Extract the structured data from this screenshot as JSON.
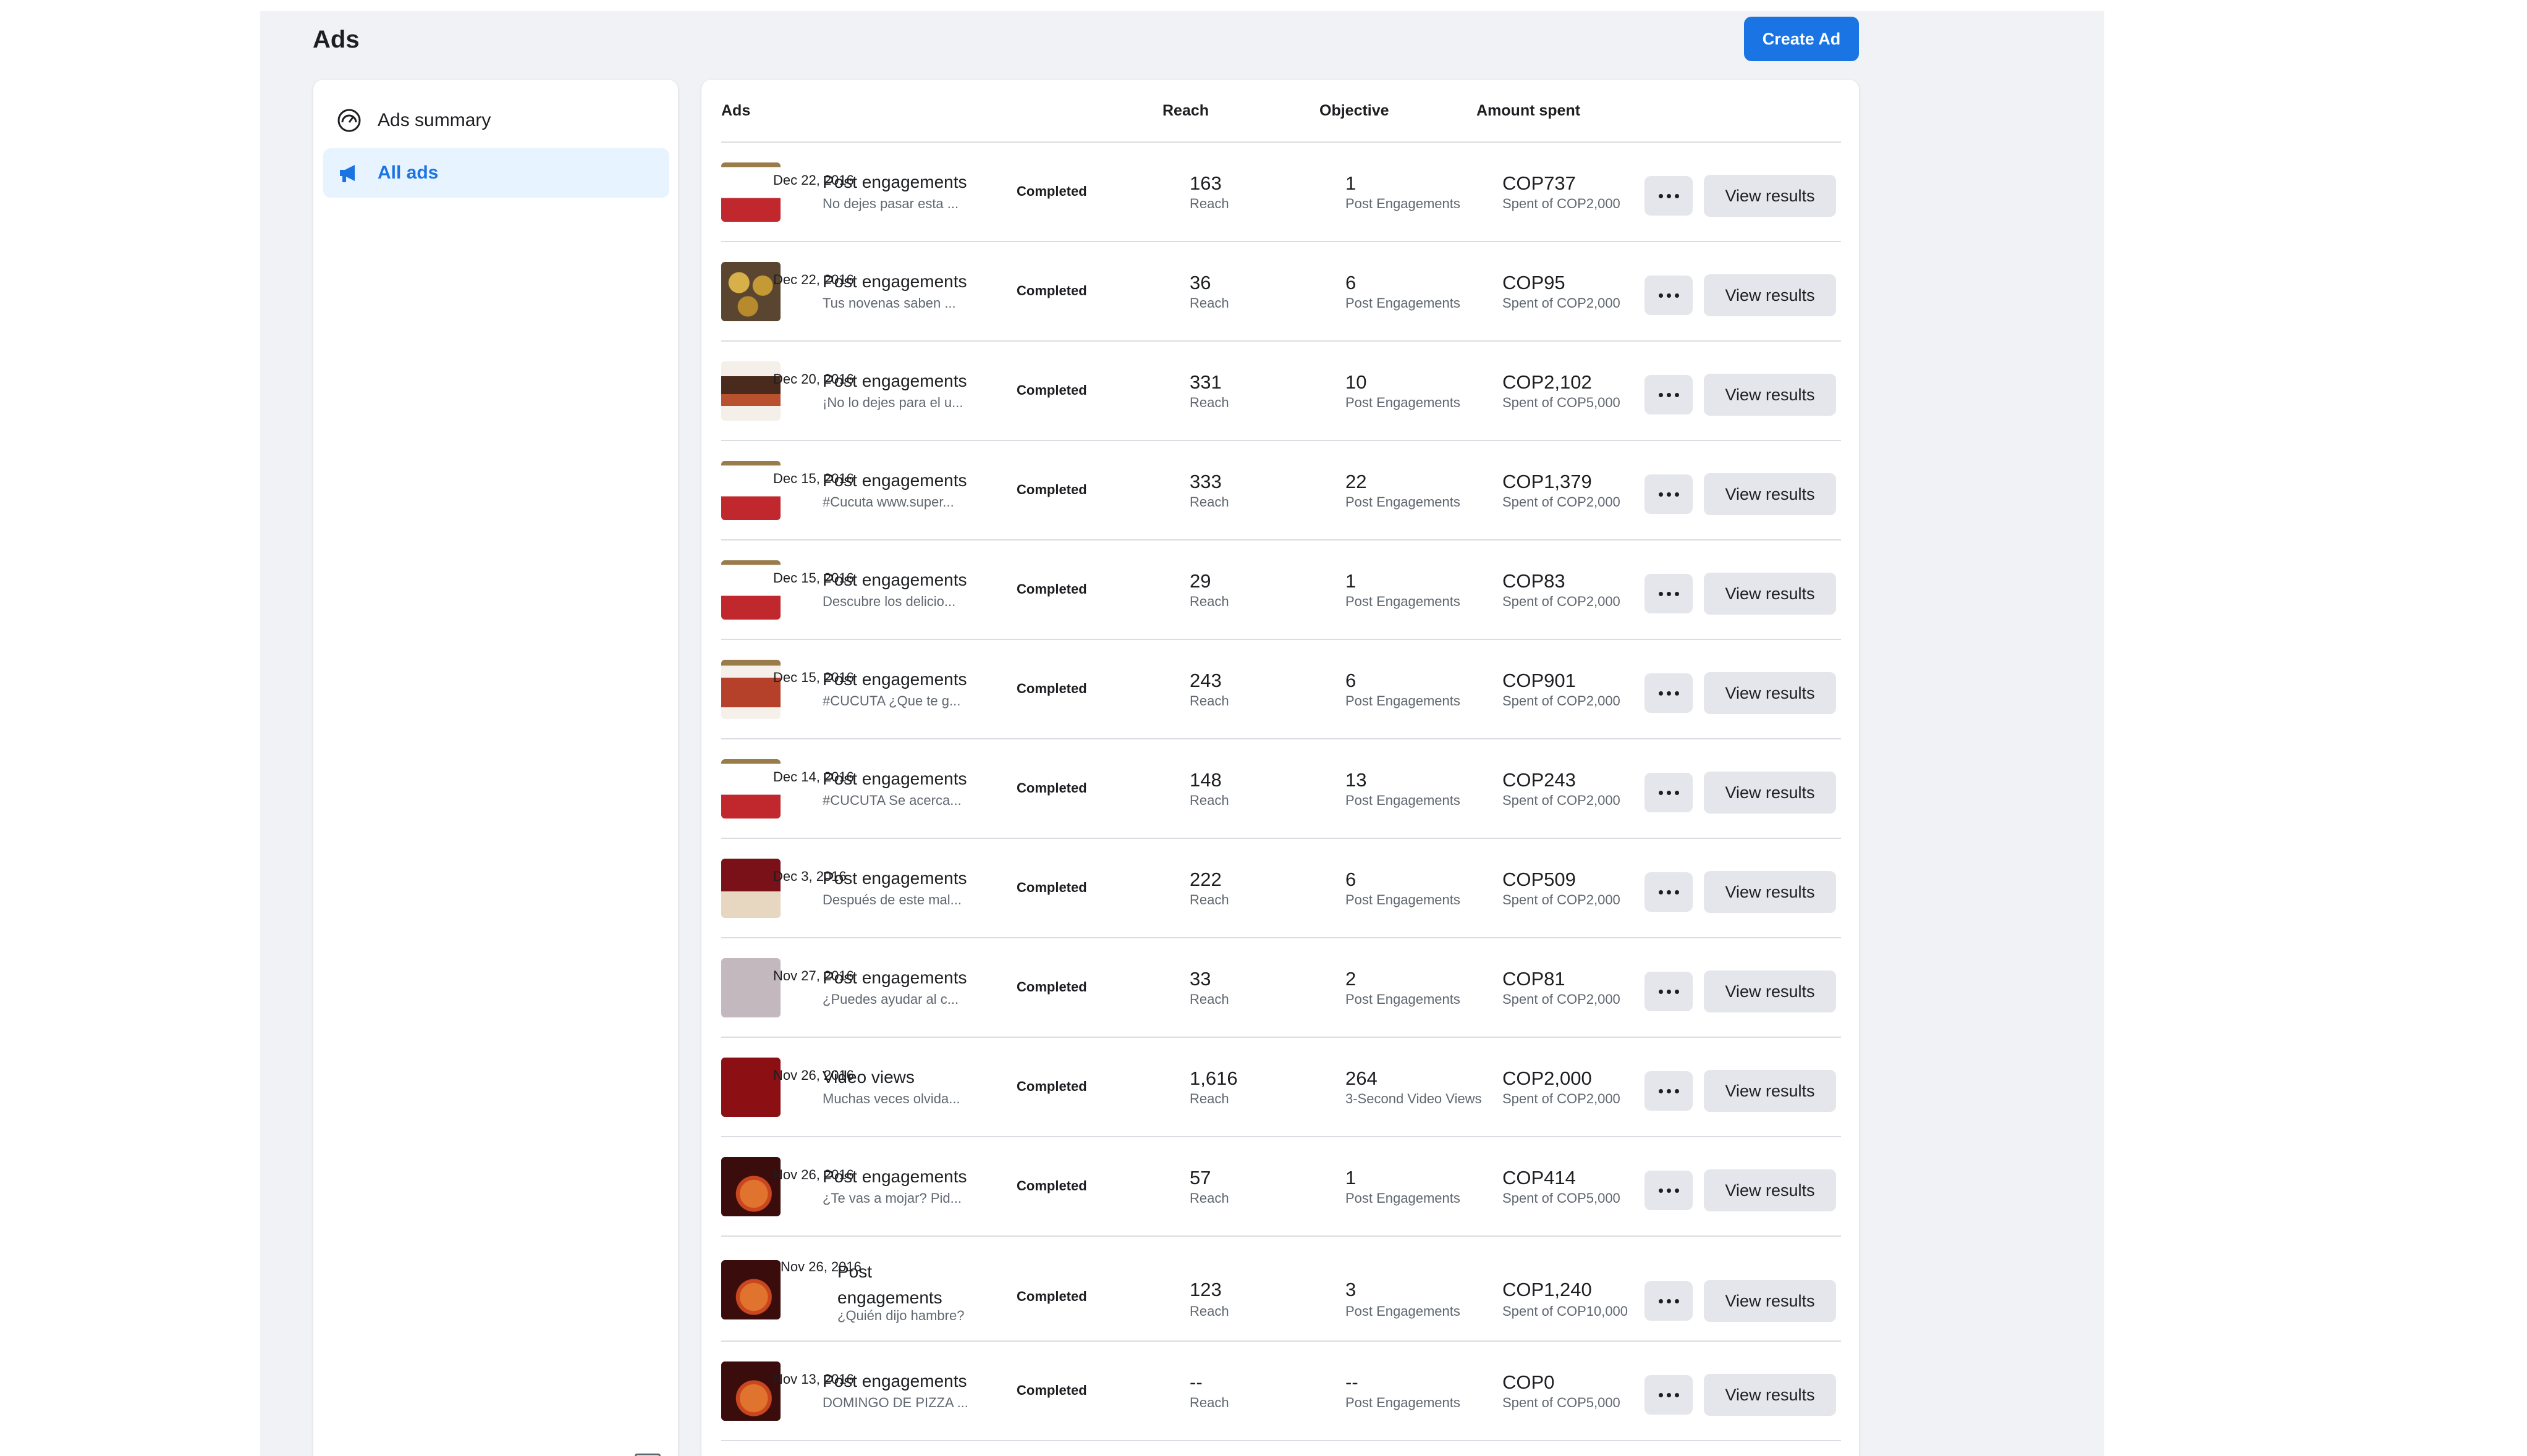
{
  "page": {
    "title": "Ads",
    "create_button": "Create Ad"
  },
  "sidebar": {
    "items": [
      {
        "label": "Ads summary",
        "icon": "gauge-icon",
        "active": false
      },
      {
        "label": "All ads",
        "icon": "megaphone-icon",
        "active": true
      }
    ]
  },
  "table": {
    "headers": {
      "ads": "Ads",
      "reach": "Reach",
      "objective": "Objective",
      "amount": "Amount spent"
    },
    "more_label": "...",
    "view_label": "View results",
    "rows": [
      {
        "date": "Dec 22, 2016",
        "title": "Post engagements",
        "text": "No dejes pasar esta ...",
        "status": "Completed",
        "reach": "163",
        "reach_label": "Reach",
        "objective_value": "1",
        "objective_label": "Post Engagements",
        "amount": "COP737",
        "budget": "Spent of COP2,000",
        "thumb": "white"
      },
      {
        "date": "Dec 22, 2016",
        "title": "Post engagements",
        "text": "Tus novenas saben ...",
        "status": "Completed",
        "reach": "36",
        "reach_label": "Reach",
        "objective_value": "6",
        "objective_label": "Post Engagements",
        "amount": "COP95",
        "budget": "Spent of COP2,000",
        "thumb": "gold"
      },
      {
        "date": "Dec 20, 2016",
        "title": "Post engagements",
        "text": "¡No lo dejes para el u...",
        "status": "Completed",
        "reach": "331",
        "reach_label": "Reach",
        "objective_value": "10",
        "objective_label": "Post Engagements",
        "amount": "COP2,102",
        "budget": "Spent of COP5,000",
        "thumb": "cake"
      },
      {
        "date": "Dec 15, 2016",
        "title": "Post engagements",
        "text": "#Cucuta www.super...",
        "status": "Completed",
        "reach": "333",
        "reach_label": "Reach",
        "objective_value": "22",
        "objective_label": "Post Engagements",
        "amount": "COP1,379",
        "budget": "Spent of COP2,000",
        "thumb": "white"
      },
      {
        "date": "Dec 15, 2016",
        "title": "Post engagements",
        "text": "Descubre los delicio...",
        "status": "Completed",
        "reach": "29",
        "reach_label": "Reach",
        "objective_value": "1",
        "objective_label": "Post Engagements",
        "amount": "COP83",
        "budget": "Spent of COP2,000",
        "thumb": "white"
      },
      {
        "date": "Dec 15, 2016",
        "title": "Post engagements",
        "text": "#CUCUTA ¿Que te g...",
        "status": "Completed",
        "reach": "243",
        "reach_label": "Reach",
        "objective_value": "6",
        "objective_label": "Post Engagements",
        "amount": "COP901",
        "budget": "Spent of COP2,000",
        "thumb": "food"
      },
      {
        "date": "Dec 14, 2016",
        "title": "Post engagements",
        "text": "#CUCUTA Se acerca...",
        "status": "Completed",
        "reach": "148",
        "reach_label": "Reach",
        "objective_value": "13",
        "objective_label": "Post Engagements",
        "amount": "COP243",
        "budget": "Spent of COP2,000",
        "thumb": "white"
      },
      {
        "date": "Dec 3, 2016",
        "title": "Post engagements",
        "text": "Después de este mal...",
        "status": "Completed",
        "reach": "222",
        "reach_label": "Reach",
        "objective_value": "6",
        "objective_label": "Post Engagements",
        "amount": "COP509",
        "budget": "Spent of COP2,000",
        "thumb": "maroon"
      },
      {
        "date": "Nov 27, 2016",
        "title": "Post engagements",
        "text": "¿Puedes ayudar al c...",
        "status": "Completed",
        "reach": "33",
        "reach_label": "Reach",
        "objective_value": "2",
        "objective_label": "Post Engagements",
        "amount": "COP81",
        "budget": "Spent of COP2,000",
        "thumb": "gray"
      },
      {
        "date": "Nov 26, 2016",
        "title": "Video views",
        "text": "Muchas veces olvida...",
        "status": "Completed",
        "reach": "1,616",
        "reach_label": "Reach",
        "objective_value": "264",
        "objective_label": "3-Second Video Views",
        "amount": "COP2,000",
        "budget": "Spent of COP2,000",
        "thumb": "red"
      },
      {
        "date": "Nov 26, 2016",
        "title": "Post engagements",
        "text": "¿Te vas a mojar? Pid...",
        "status": "Completed",
        "reach": "57",
        "reach_label": "Reach",
        "objective_value": "1",
        "objective_label": "Post Engagements",
        "amount": "COP414",
        "budget": "Spent of COP5,000",
        "thumb": "pizza"
      },
      {
        "date": "Nov 26, 2016",
        "title": "Post engagements",
        "text": "¿Quién dijo hambre?",
        "status": "Completed",
        "reach": "123",
        "reach_label": "Reach",
        "objective_value": "3",
        "objective_label": "Post Engagements",
        "amount": "COP1,240",
        "budget": "Spent of COP10,000",
        "thumb": "pizza"
      },
      {
        "date": "Nov 13, 2016",
        "title": "Post engagements",
        "text": "DOMINGO DE PIZZA ...",
        "status": "Completed",
        "reach": "--",
        "reach_label": "Reach",
        "objective_value": "--",
        "objective_label": "Post Engagements",
        "amount": "COP0",
        "budget": "Spent of COP5,000",
        "thumb": "pizza"
      }
    ]
  }
}
